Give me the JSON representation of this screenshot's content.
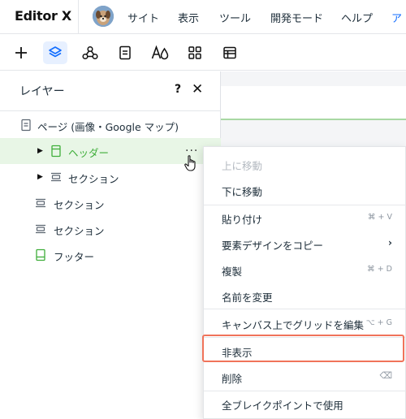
{
  "topbar": {
    "brand": "Editor X",
    "menus": [
      "サイト",
      "表示",
      "ツール",
      "開発モード",
      "ヘルプ",
      "ア"
    ]
  },
  "toolbar": {
    "tools": [
      "add-icon",
      "layers-icon",
      "connect-icon",
      "pages-icon",
      "typography-icon",
      "apps-icon",
      "table-icon"
    ],
    "active_tool": "layers-icon"
  },
  "panel": {
    "title": "レイヤー",
    "help": "?",
    "close": "✕",
    "layers": [
      {
        "label": "ページ (画像・Google マップ)",
        "icon": "page-icon",
        "selected": false
      },
      {
        "label": "ヘッダー",
        "icon": "header-icon",
        "selected": true,
        "expandable": true
      },
      {
        "label": "セクション",
        "icon": "section-icon",
        "selected": false,
        "expandable": true
      },
      {
        "label": "セクション",
        "icon": "section-icon",
        "selected": false
      },
      {
        "label": "セクション",
        "icon": "section-icon",
        "selected": false
      },
      {
        "label": "フッター",
        "icon": "footer-icon",
        "selected": false
      }
    ],
    "more": "···"
  },
  "context_menu": {
    "items": [
      {
        "label": "上に移動",
        "disabled": true
      },
      {
        "label": "下に移動"
      },
      {
        "label": "貼り付け",
        "shortcut": "⌘ + V"
      },
      {
        "label": "要素デザインをコピー",
        "submenu": "›"
      },
      {
        "label": "複製",
        "shortcut": "⌘ + D"
      },
      {
        "label": "名前を変更"
      },
      {
        "label": "キャンバス上でグリッドを編集",
        "shortcut": "⌥ + G"
      },
      {
        "label": "非表示",
        "highlighted": true
      },
      {
        "label": "削除",
        "shortcut": "⌫"
      },
      {
        "label": "全ブレイクポイントで使用"
      }
    ]
  },
  "colors": {
    "accent_blue": "#116dff",
    "selected_green": "#3fae3a",
    "highlight_outline": "#f0735a"
  }
}
